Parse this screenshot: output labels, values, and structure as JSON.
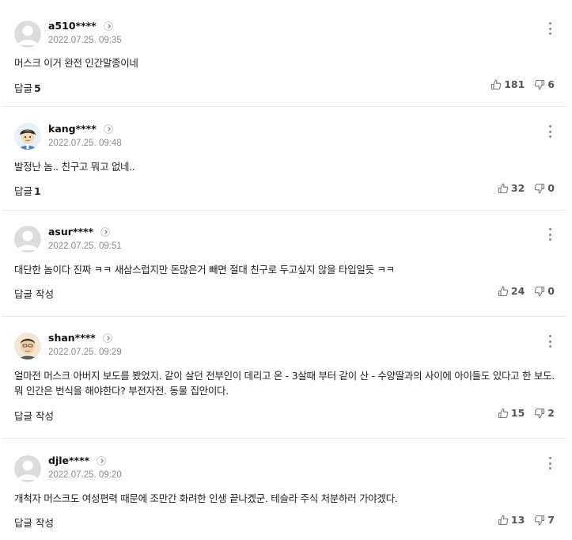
{
  "reply_label": "답글",
  "write_reply_label": "답글 작성",
  "comments": [
    {
      "user": "a510****",
      "avatar": "default-avatar-icon",
      "date": "2022.07.25. 09:35",
      "text": "머스크 이거 완전 인간말종이네",
      "reply_count": "5",
      "likes": "181",
      "dislikes": "6"
    },
    {
      "user": "kang****",
      "avatar": "cartoon-face-avatar-icon",
      "date": "2022.07.25. 09:48",
      "text": "발정난 놈.. 친구고 뭐고 없네..",
      "reply_count": "1",
      "likes": "32",
      "dislikes": "0"
    },
    {
      "user": "asur****",
      "avatar": "default-avatar-icon",
      "date": "2022.07.25. 09:51",
      "text": "대단한 놈이다 진짜 ㅋㅋ 새삼스럽지만 돈많은거 빼면 절대 친구로 두고싶지 않을 타입일듯 ㅋㅋ",
      "reply_count": "",
      "likes": "24",
      "dislikes": "0"
    },
    {
      "user": "shan****",
      "avatar": "cartoon-face-avatar-icon",
      "date": "2022.07.25. 09:29",
      "text": "얼마전 머스크 아버지 보도를 봤었지. 같이 살던 전부인이 데리고 온 - 3살때 부터 같이 산 - 수양딸과의 사이에 아이들도 있다고 한 보도. 뭐 인간은 번식을 해야한다? 부전자전. 동물 집안이다.",
      "reply_count": "",
      "likes": "15",
      "dislikes": "2"
    },
    {
      "user": "djle****",
      "avatar": "default-avatar-icon",
      "date": "2022.07.25. 09:20",
      "text": "개척자 머스크도 여성편력 때문에 조만간 화려한 인생 끝나겠군. 테슬라 주식 처분하러 가야겠다.",
      "reply_count": "",
      "likes": "13",
      "dislikes": "7"
    }
  ]
}
